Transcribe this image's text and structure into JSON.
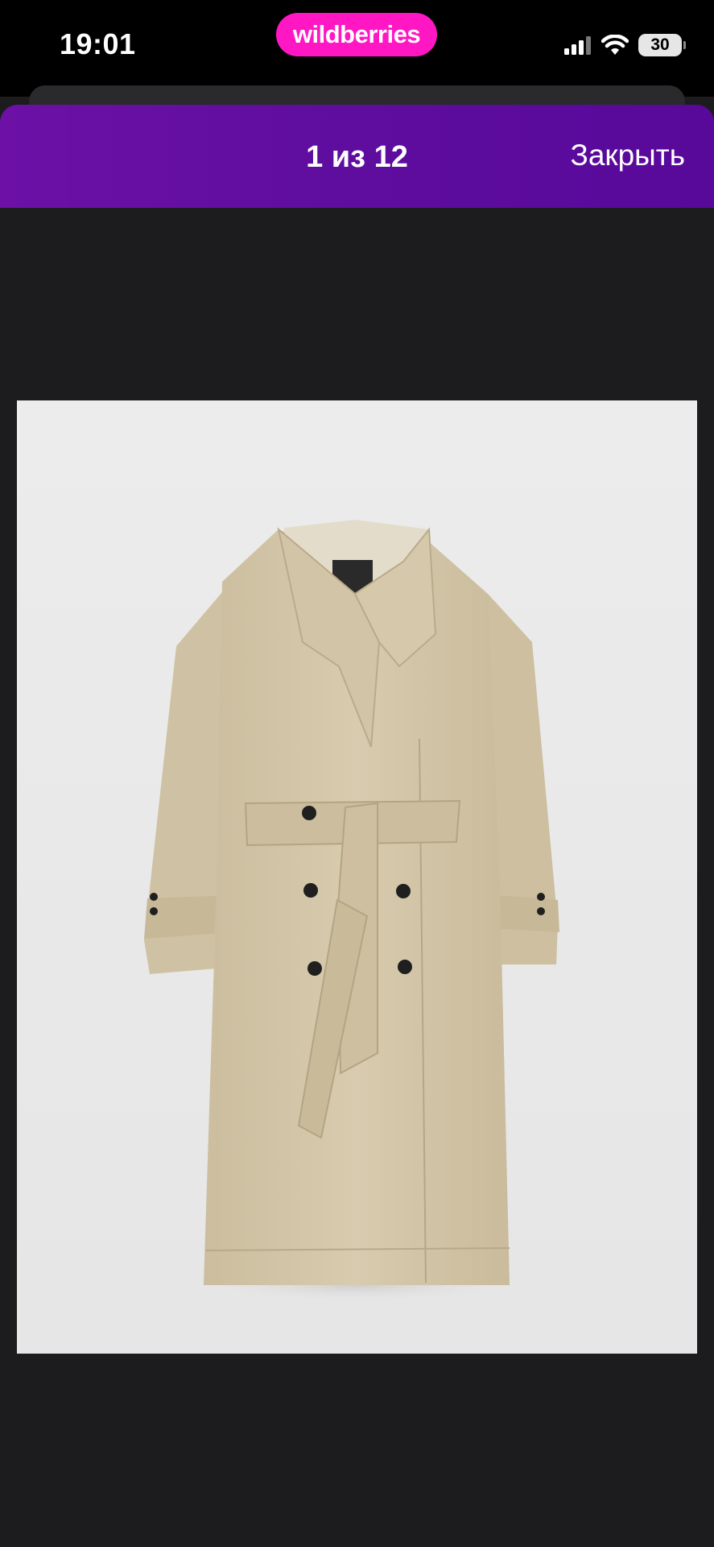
{
  "status_bar": {
    "time": "19:01",
    "brand": "wildberries",
    "battery": "30",
    "brand_color": "#ff17c4",
    "icons": [
      "signal-icon",
      "wifi-icon",
      "battery-icon"
    ]
  },
  "viewer": {
    "counter": "1 из 12",
    "close_label": "Закрыть",
    "header_color": "#5e0d9e"
  },
  "photo": {
    "subject": "coat-image",
    "background_color": "#ebebeb",
    "garment_color": "#d5c8aa"
  }
}
